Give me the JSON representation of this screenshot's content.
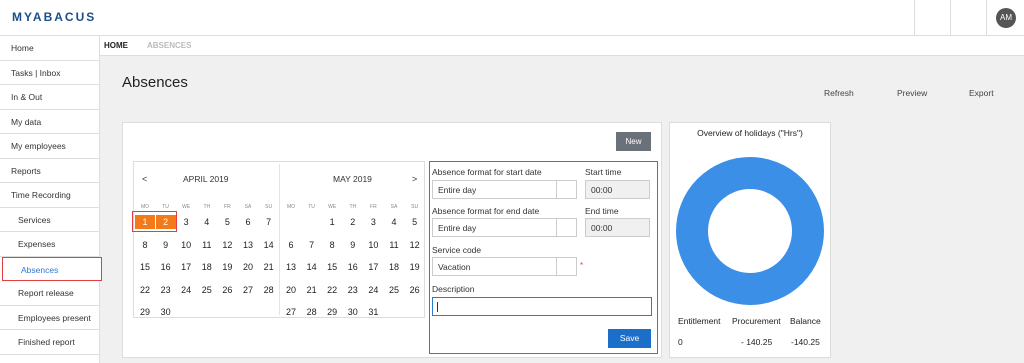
{
  "app": {
    "logo": "MYABACUS"
  },
  "user": {
    "initials": "AM"
  },
  "sidebar": {
    "items": [
      {
        "label": "Home"
      },
      {
        "label": "Tasks | Inbox"
      },
      {
        "label": "In & Out"
      },
      {
        "label": "My data"
      },
      {
        "label": "My employees"
      },
      {
        "label": "Reports"
      },
      {
        "label": "Time Recording"
      },
      {
        "label": "Services"
      },
      {
        "label": "Expenses"
      },
      {
        "label": "Absences"
      },
      {
        "label": "Report release"
      },
      {
        "label": "Employees present"
      },
      {
        "label": "Finished report"
      }
    ]
  },
  "breadcrumb": {
    "home": "HOME",
    "current": "ABSENCES"
  },
  "page": {
    "title": "Absences"
  },
  "actions": {
    "refresh": "Refresh",
    "preview": "Preview",
    "export": "Export"
  },
  "buttons": {
    "new": "New",
    "save": "Save"
  },
  "calendar": {
    "prev": "<",
    "next": ">",
    "weekdays": [
      "MO",
      "TU",
      "WE",
      "TH",
      "FR",
      "SA",
      "SU"
    ],
    "april": {
      "title": "APRIL 2019",
      "weeks": [
        [
          "1",
          "2",
          "3",
          "4",
          "5",
          "6",
          "7"
        ],
        [
          "8",
          "9",
          "10",
          "11",
          "12",
          "13",
          "14"
        ],
        [
          "15",
          "16",
          "17",
          "18",
          "19",
          "20",
          "21"
        ],
        [
          "22",
          "23",
          "24",
          "25",
          "26",
          "27",
          "28"
        ],
        [
          "29",
          "30",
          "",
          "",
          "",
          "",
          ""
        ]
      ]
    },
    "may": {
      "title": "MAY 2019",
      "weeks": [
        [
          "",
          "",
          "1",
          "2",
          "3",
          "4",
          "5"
        ],
        [
          "6",
          "7",
          "8",
          "9",
          "10",
          "11",
          "12"
        ],
        [
          "13",
          "14",
          "15",
          "16",
          "17",
          "18",
          "19"
        ],
        [
          "20",
          "21",
          "22",
          "23",
          "24",
          "25",
          "26"
        ],
        [
          "27",
          "28",
          "29",
          "30",
          "31",
          "",
          ""
        ]
      ]
    },
    "selected_days": [
      "1",
      "2"
    ],
    "selected_color": "#f27a1a"
  },
  "form": {
    "start_format_label": "Absence format for start date",
    "start_format_value": "Entire day",
    "start_time_label": "Start time",
    "start_time_value": "00:00",
    "end_format_label": "Absence format for end date",
    "end_format_value": "Entire day",
    "end_time_label": "End time",
    "end_time_value": "00:00",
    "service_code_label": "Service code",
    "service_code_value": "Vacation",
    "required_marker": "*",
    "description_label": "Description",
    "description_value": ""
  },
  "holidays": {
    "title": "Overview of holidays (\"Hrs\")",
    "chart_color": "#3b8fe6",
    "labels": {
      "entitlement": "Entitlement",
      "procurement": "Procurement",
      "balance": "Balance"
    },
    "values": {
      "entitlement": "0",
      "procurement": "- 140.25",
      "balance": "-140.25"
    }
  },
  "colors": {
    "accent": "#1c6fc8",
    "highlight": "#e04040"
  }
}
